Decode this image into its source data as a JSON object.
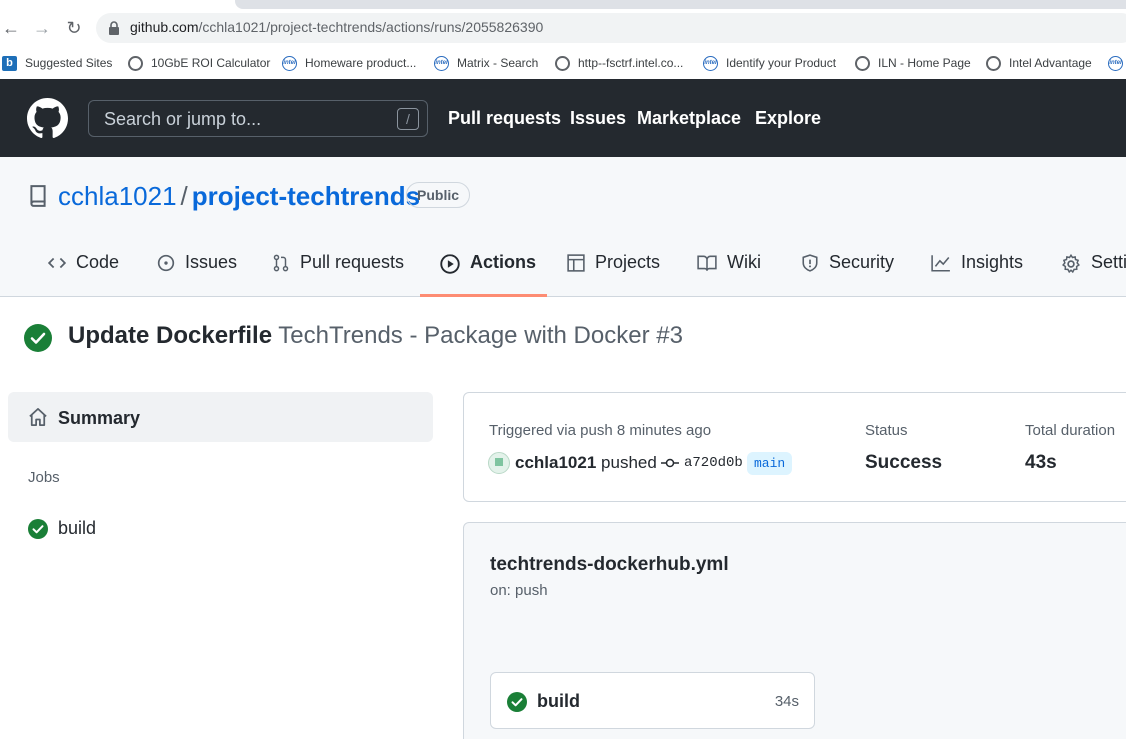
{
  "browser": {
    "url_host": "github.com",
    "url_path": "/cchla1021/project-techtrends/actions/runs/2055826390",
    "bookmarks": [
      {
        "label": "Suggested Sites",
        "icon": "bing-icon"
      },
      {
        "label": "10GbE ROI Calculator",
        "icon": "globe-icon"
      },
      {
        "label": "Homeware product...",
        "icon": "intel-icon"
      },
      {
        "label": "Matrix - Search",
        "icon": "intel-icon"
      },
      {
        "label": "http--fsctrf.intel.co...",
        "icon": "globe-icon"
      },
      {
        "label": "Identify your Product",
        "icon": "intel-icon"
      },
      {
        "label": "ILN - Home Page",
        "icon": "globe-icon"
      },
      {
        "label": "Intel Advantage",
        "icon": "globe-icon"
      }
    ]
  },
  "header": {
    "search_placeholder": "Search or jump to...",
    "search_shortcut": "/",
    "nav": [
      "Pull requests",
      "Issues",
      "Marketplace",
      "Explore"
    ]
  },
  "repo": {
    "owner": "cchla1021",
    "separator": "/",
    "name": "project-techtrends",
    "visibility": "Public",
    "tabs": [
      {
        "label": "Code",
        "icon": "code-icon"
      },
      {
        "label": "Issues",
        "icon": "issue-icon"
      },
      {
        "label": "Pull requests",
        "icon": "pull-request-icon"
      },
      {
        "label": "Actions",
        "icon": "play-icon",
        "active": true
      },
      {
        "label": "Projects",
        "icon": "table-icon"
      },
      {
        "label": "Wiki",
        "icon": "book-icon"
      },
      {
        "label": "Security",
        "icon": "shield-icon"
      },
      {
        "label": "Insights",
        "icon": "graph-icon"
      },
      {
        "label": "Settings",
        "icon": "gear-icon"
      }
    ]
  },
  "run": {
    "commit_title": "Update Dockerfile",
    "workflow_title": "TechTrends - Package with Docker #3"
  },
  "sidebar": {
    "summary_label": "Summary",
    "jobs_heading": "Jobs",
    "jobs": [
      "build"
    ]
  },
  "summary": {
    "trigger_label": "Triggered via push 8 minutes ago",
    "user": "cchla1021",
    "action": "pushed",
    "sha": "a720d0b",
    "branch": "main",
    "status_label": "Status",
    "status_value": "Success",
    "duration_label": "Total duration",
    "duration_value": "43s"
  },
  "graph": {
    "file": "techtrends-dockerhub.yml",
    "trigger": "on: push",
    "job": {
      "name": "build",
      "duration": "34s"
    }
  },
  "colors": {
    "success": "#1a7f37",
    "link": "#0969da",
    "header_bg": "#24292f",
    "active_tab": "#fd8c73"
  }
}
